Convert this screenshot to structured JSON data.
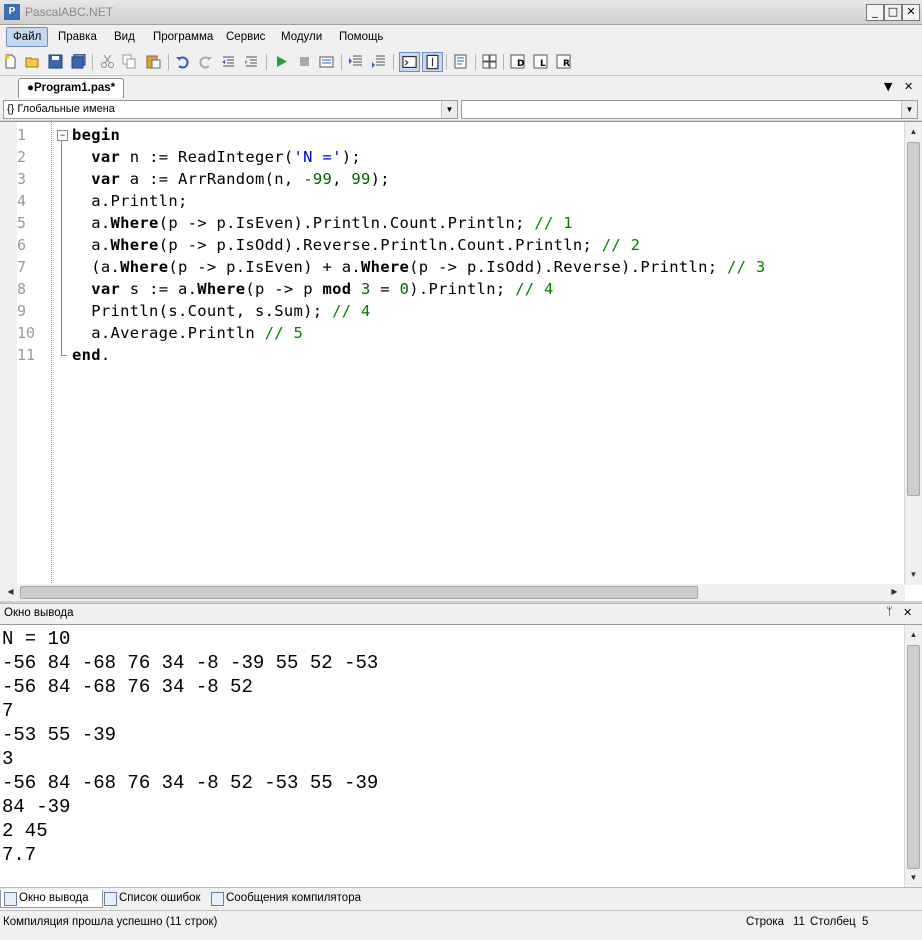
{
  "window": {
    "title": "PascalABC.NET",
    "min": "_",
    "max": "□",
    "close": "✕"
  },
  "menu": [
    "Файл",
    "Правка",
    "Вид",
    "Программа",
    "Сервис",
    "Модули",
    "Помощь"
  ],
  "toolbar_icons": [
    "new-file-icon",
    "open-file-icon",
    "save-icon",
    "save-all-icon",
    "cut-icon",
    "copy-icon",
    "paste-icon",
    "undo-icon",
    "redo-icon",
    "unindent-icon",
    "indent-icon",
    "run-icon",
    "stop-icon",
    "debug-icon",
    "step-into-icon",
    "step-over-icon",
    "console-toggle-icon",
    "output-toggle-icon",
    "format-code-icon",
    "form-designer-icon",
    "snippet-d-icon",
    "snippet-l-icon",
    "snippet-r-icon"
  ],
  "editor": {
    "tab_label": "●Program1.pas*",
    "tab_close": "✕",
    "tab_menu": "▼",
    "scope_combo": "{} Глобальные имена",
    "member_combo": "",
    "line_numbers": [
      "1",
      "2",
      "3",
      "4",
      "5",
      "6",
      "7",
      "8",
      "9",
      "10",
      "11"
    ],
    "code": [
      [
        [
          "kw",
          "begin"
        ]
      ],
      [
        [
          "t",
          "  "
        ],
        [
          "kw",
          "var"
        ],
        [
          "t",
          " n := ReadInteger("
        ],
        [
          "str",
          "'N ='"
        ],
        [
          "t",
          ");"
        ]
      ],
      [
        [
          "t",
          "  "
        ],
        [
          "kw",
          "var"
        ],
        [
          "t",
          " a := ArrRandom(n, "
        ],
        [
          "num",
          "-99"
        ],
        [
          "t",
          ", "
        ],
        [
          "num",
          "99"
        ],
        [
          "t",
          ");"
        ]
      ],
      [
        [
          "t",
          "  a.Println;"
        ]
      ],
      [
        [
          "t",
          "  a."
        ],
        [
          "kw",
          "Where"
        ],
        [
          "t",
          "(p -> p.IsEven).Println.Count.Println; "
        ],
        [
          "cmt",
          "// 1"
        ]
      ],
      [
        [
          "t",
          "  a."
        ],
        [
          "kw",
          "Where"
        ],
        [
          "t",
          "(p -> p.IsOdd).Reverse.Println.Count.Println; "
        ],
        [
          "cmt",
          "// 2"
        ]
      ],
      [
        [
          "t",
          "  (a."
        ],
        [
          "kw",
          "Where"
        ],
        [
          "t",
          "(p -> p.IsEven) + a."
        ],
        [
          "kw",
          "Where"
        ],
        [
          "t",
          "(p -> p.IsOdd).Reverse).Println; "
        ],
        [
          "cmt",
          "// 3"
        ]
      ],
      [
        [
          "t",
          "  "
        ],
        [
          "kw",
          "var"
        ],
        [
          "t",
          " s := a."
        ],
        [
          "kw",
          "Where"
        ],
        [
          "t",
          "(p -> p "
        ],
        [
          "kw",
          "mod"
        ],
        [
          "t",
          " "
        ],
        [
          "num",
          "3"
        ],
        [
          "t",
          " = "
        ],
        [
          "num",
          "0"
        ],
        [
          "t",
          ").Println; "
        ],
        [
          "cmt",
          "// 4"
        ]
      ],
      [
        [
          "t",
          "  Println(s.Count, s.Sum); "
        ],
        [
          "cmt",
          "// 4"
        ]
      ],
      [
        [
          "t",
          "  a.Average.Println "
        ],
        [
          "cmt",
          "// 5"
        ]
      ],
      [
        [
          "kw",
          "end"
        ],
        [
          "t",
          "."
        ]
      ]
    ]
  },
  "output_panel": {
    "title": "Окно вывода",
    "pin": "ᛘ",
    "close": "✕",
    "lines": [
      "N = 10",
      "-56 84 -68 76 34 -8 -39 55 52 -53",
      "-56 84 -68 76 34 -8 52",
      "7",
      "-53 55 -39",
      "3",
      "-56 84 -68 76 34 -8 52 -53 55 -39",
      "84 -39",
      "2 45",
      "7.7"
    ]
  },
  "bottom_tabs": [
    "Окно вывода",
    "Список ошибок",
    "Сообщения компилятора"
  ],
  "status": {
    "message": "Компиляция прошла успешно (11 строк)",
    "row_label": "Строка",
    "row_value": "11",
    "col_label": "Столбец",
    "col_value": "5"
  }
}
